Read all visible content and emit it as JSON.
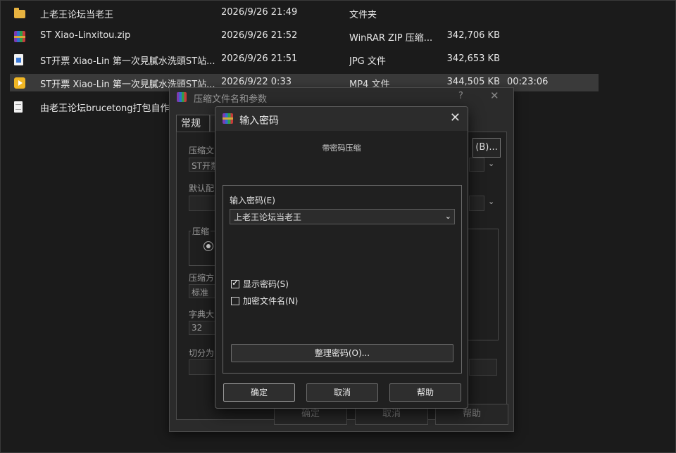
{
  "files": [
    {
      "icon": "folder-icon",
      "name": "上老王论坛当老王",
      "date": "2026/9/26 21:49",
      "type": "文件夹",
      "size": "",
      "duration": "",
      "selected": false
    },
    {
      "icon": "winrar-icon",
      "name": "ST Xiao-Linxitou.zip",
      "date": "2026/9/26 21:52",
      "type": "WinRAR ZIP 压缩...",
      "size": "342,706 KB",
      "duration": "",
      "selected": false
    },
    {
      "icon": "jpg-file-icon",
      "name": "ST开票 Xiao-Lin 第一次見膩水洗頭ST站...",
      "date": "2026/9/26 21:51",
      "type": "JPG 文件",
      "size": "342,653 KB",
      "duration": "",
      "selected": false
    },
    {
      "icon": "mp4-file-icon",
      "name": "ST开票 Xiao-Lin 第一次見膩水洗頭ST站...",
      "date": "2026/9/22 0:33",
      "type": "MP4 文件",
      "size": "344,505 KB",
      "duration": "00:23:06",
      "selected": true
    },
    {
      "icon": "text-file-icon",
      "name": "由老王论坛brucetong打包自作.txt",
      "date": "",
      "type": "",
      "size": "",
      "duration": "",
      "selected": false
    }
  ],
  "back_dialog": {
    "title": "压缩文件名和参数",
    "help": "?",
    "tab_general": "常规",
    "archive_name_label": "压缩文",
    "archive_name_value": "ST开票",
    "browse_button": "(B)...",
    "default_profile_label": "默认配",
    "archive_format_label": "压缩",
    "compression_method_label": "压缩方",
    "compression_method_value": "标准",
    "dictionary_label": "字典大",
    "dictionary_value": "32",
    "split_label": "切分为",
    "ok": "确定",
    "cancel": "取消",
    "help_button": "帮助"
  },
  "dialog": {
    "title": "输入密码",
    "subtitle": "带密码压缩",
    "password_label": "输入密码(E)",
    "password_value": "上老王论坛当老王",
    "show_password": "显示密码(S)",
    "show_password_checked": true,
    "encrypt_filenames": "加密文件名(N)",
    "encrypt_filenames_checked": false,
    "organize_button": "整理密码(O)...",
    "ok": "确定",
    "cancel": "取消",
    "help": "帮助"
  }
}
